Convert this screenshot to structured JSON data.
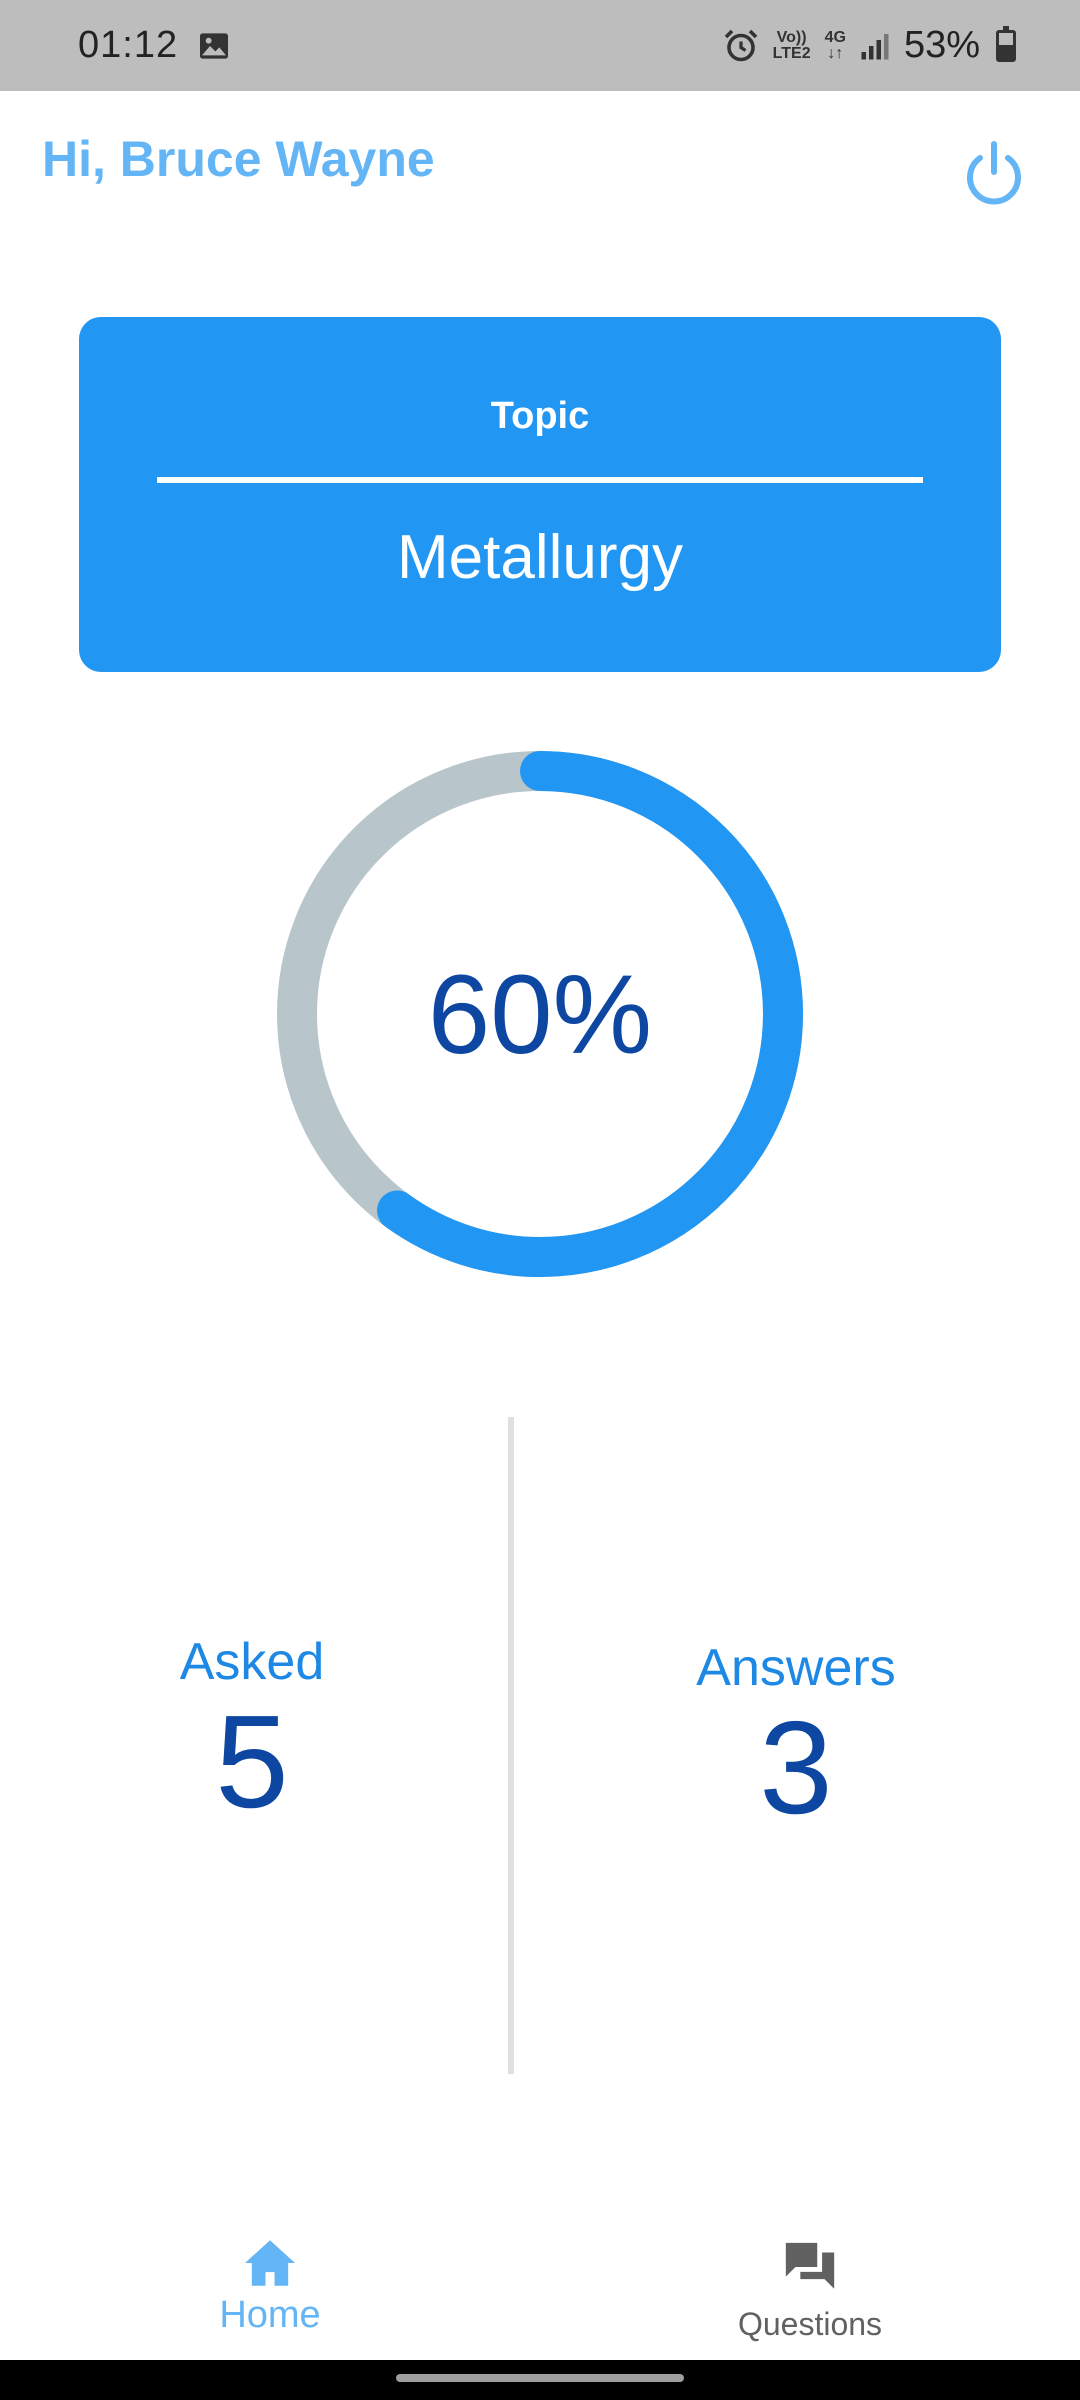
{
  "status_bar": {
    "time": "01:12",
    "volte_line1": "Vo))",
    "volte_line2": "LTE2",
    "network": "4G",
    "battery_text": "53%"
  },
  "header": {
    "greeting": "Hi, Bruce Wayne"
  },
  "topic": {
    "label": "Topic",
    "value": "Metallurgy"
  },
  "progress": {
    "text": "60%",
    "fraction": 0.6
  },
  "stats": {
    "asked_label": "Asked",
    "asked_value": "5",
    "answers_label": "Answers",
    "answers_value": "3"
  },
  "bottom_nav": {
    "home_label": "Home",
    "questions_label": "Questions"
  },
  "colors": {
    "primary": "#2196f3",
    "accent_light": "#64b5f6",
    "dark_blue": "#0d47a1",
    "ring_track": "#b8c6cc"
  },
  "icons": {
    "gallery": "image-icon",
    "alarm": "alarm-icon",
    "signal": "signal-icon",
    "battery": "battery-icon",
    "power": "power-icon",
    "home": "home-icon",
    "questions": "chat-icon"
  }
}
